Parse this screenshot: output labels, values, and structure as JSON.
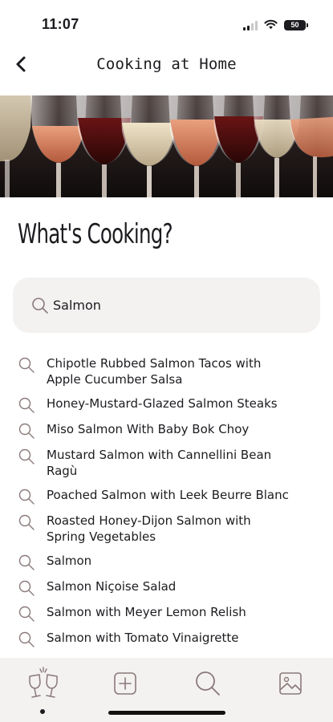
{
  "status_bar": {
    "time": "11:07",
    "battery": "50",
    "icons": [
      "signal-icon",
      "wifi-icon",
      "battery-icon"
    ]
  },
  "nav": {
    "title": "Cooking at Home",
    "back_icon": "chevron-left-icon"
  },
  "hero": {
    "description_icon": "wine-glasses-banner"
  },
  "page": {
    "title": "What's Cooking?"
  },
  "search": {
    "value": "Salmon",
    "icon": "search-icon"
  },
  "results": [
    {
      "line1": "Chipotle Rubbed Salmon Tacos with",
      "line2": "Apple Cucumber Salsa"
    },
    {
      "line1": "Honey-Mustard-Glazed Salmon Steaks",
      "line2": ""
    },
    {
      "line1": "Miso Salmon With Baby Bok Choy",
      "line2": ""
    },
    {
      "line1": "Mustard Salmon with Cannellini Bean",
      "line2": "Ragù"
    },
    {
      "line1": "Poached Salmon with Leek Beurre Blanc",
      "line2": ""
    },
    {
      "line1": "Roasted Honey-Dijon Salmon with",
      "line2": "Spring Vegetables"
    },
    {
      "line1": "Salmon",
      "line2": ""
    },
    {
      "line1": "Salmon Niçoise Salad",
      "line2": ""
    },
    {
      "line1": "Salmon with Meyer Lemon Relish",
      "line2": ""
    },
    {
      "line1": "Salmon with Tomato Vinaigrette",
      "line2": ""
    }
  ],
  "tab_bar": {
    "tabs": [
      {
        "icon": "wine-glasses-cheers-icon",
        "selected": true
      },
      {
        "icon": "add-square-icon",
        "selected": false
      },
      {
        "icon": "search-icon",
        "selected": false
      },
      {
        "icon": "image-icon",
        "selected": false
      }
    ]
  },
  "colors": {
    "text": "#1c1b1f",
    "search_background": "#f4f1f1",
    "tab_bar_background": "#f4f1f1",
    "icon_stroke": "#8a7a7a"
  }
}
